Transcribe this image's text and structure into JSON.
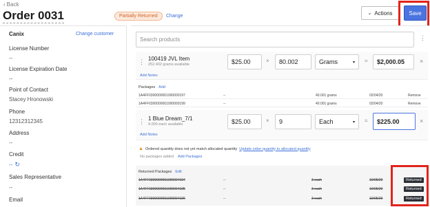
{
  "header": {
    "back_label": "Back",
    "title": "Order 0031",
    "status_badge": "Partially Returned",
    "change_link": "Change",
    "actions_label": "Actions",
    "save_label": "Save"
  },
  "sidebar": {
    "customer_name": "Canix",
    "change_customer": "Change customer",
    "fields": [
      {
        "label": "License Number",
        "value": "--"
      },
      {
        "label": "License Expiration Date",
        "value": "--"
      },
      {
        "label": "Point of Contact",
        "value": "Stacey Hronowski"
      },
      {
        "label": "Phone",
        "value": "12312312345"
      },
      {
        "label": "Address",
        "value": "--"
      },
      {
        "label": "Credit",
        "value": "--"
      },
      {
        "label": "Sales Representative",
        "value": "--"
      },
      {
        "label": "Email",
        "value": ""
      }
    ]
  },
  "search": {
    "placeholder": "Search products"
  },
  "items": [
    {
      "name": "100419 JVL Item",
      "available": "252.402 grams available",
      "price": "$25.00",
      "qty": "80.002",
      "unit": "Grams",
      "total": "$2,000.05",
      "add_notes": "Add Notes",
      "packages_label": "Packages",
      "add_label": "Add",
      "packages": [
        {
          "id": "1A4FF0300000001000000197",
          "dash": "--",
          "qty": "40.001 grams",
          "date": "02/04/20",
          "action": "Remove"
        },
        {
          "id": "1A4FF0300000001000000199",
          "dash": "--",
          "qty": "40.001 grams",
          "date": "02/04/20",
          "action": "Remove"
        }
      ]
    },
    {
      "name": "1 Blue Dream_7/1",
      "available": "9.000 each available",
      "price": "$25.00",
      "qty": "9",
      "unit": "Each",
      "total": "$225.00",
      "add_notes": "Add Notes",
      "warning": "Ordered quantity does not yet match allocated quantity",
      "warning_link": "Update order quantity to allocated quantity",
      "no_packages": "No packages added",
      "add_packages": "Add Packages"
    }
  ],
  "returned": {
    "label": "Returned Packages",
    "edit": "Edit",
    "rows": [
      {
        "id": "1A4FF0300000001000004194",
        "dash": "--",
        "qty": "3 each",
        "date": "10/05/20",
        "status": "Returned"
      },
      {
        "id": "1A4FF0300000001000004195",
        "dash": "--",
        "qty": "3 each",
        "date": "10/05/20",
        "status": "Returned"
      },
      {
        "id": "1A4FF0300000001000004196",
        "dash": "--",
        "qty": "3 each",
        "date": "10/05/20",
        "status": "Returned"
      }
    ]
  },
  "colors": {
    "accent": "#4a74e0",
    "highlight": "#e2231a",
    "badge_bg": "#fde9dc",
    "badge_text": "#d0642a"
  }
}
